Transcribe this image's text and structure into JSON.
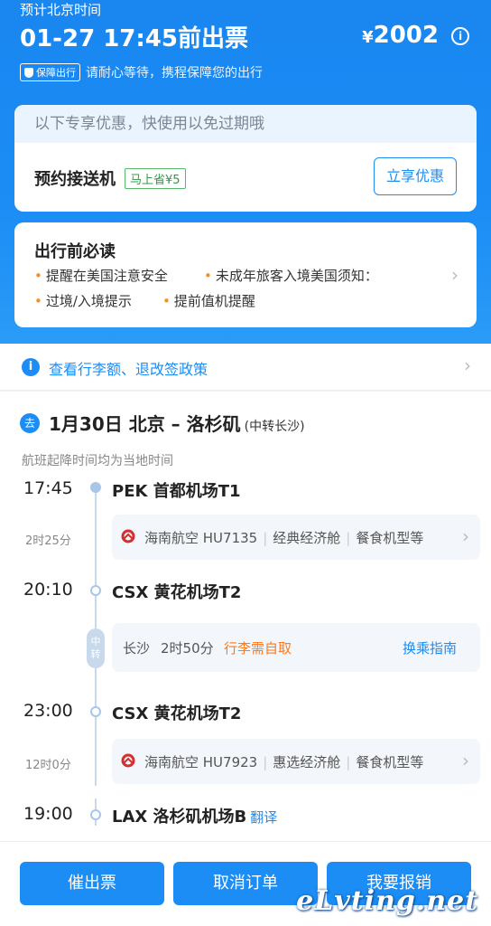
{
  "header": {
    "subtitle": "预计北京时间",
    "title": "01-27 17:45前出票",
    "price_symbol": "¥",
    "price": "2002",
    "guarantee_badge": "保障出行",
    "guarantee_text": "请耐心等待，携程保障您的出行"
  },
  "promo": {
    "banner": "以下专享优惠，快使用以免过期哦",
    "item_name": "预约接送机",
    "tag": "马上省¥5",
    "button": "立享优惠"
  },
  "notice": {
    "title": "出行前必读",
    "items": [
      "提醒在美国注意安全",
      "未成年旅客入境美国须知：",
      "过境/入境提示",
      "提前值机提醒"
    ]
  },
  "policy": {
    "text": "查看行李额、退改签政策"
  },
  "itinerary": {
    "badge": "去",
    "route": "1月30日  北京 – 洛杉矶",
    "route_note": "(中转长沙)",
    "local_time_note": "航班起降时间均为当地时间",
    "segments": [
      {
        "time": "17:45",
        "airport": "PEK 首都机场T1"
      },
      {
        "time": "20:10",
        "airport": "CSX 黄花机场T2"
      },
      {
        "time": "23:00",
        "airport": "CSX 黄花机场T2"
      },
      {
        "time": "19:00",
        "airport": "LAX 洛杉矶机场B",
        "translate": "翻译"
      }
    ],
    "flights": [
      {
        "duration": "2时25分",
        "airline": "海南航空 HU7135",
        "cabin": "经典经济舱",
        "meal": "餐食机型等"
      },
      {
        "duration": "12时0分",
        "airline": "海南航空 HU7923",
        "cabin": "惠选经济舱",
        "meal": "餐食机型等"
      }
    ],
    "transfer": {
      "marker": "中转",
      "city": "长沙",
      "duration": "2时50分",
      "baggage": "行李需自取",
      "guide": "换乘指南"
    }
  },
  "footer": {
    "buttons": [
      "催出票",
      "取消订单",
      "我要报销"
    ],
    "watermark": "eLvting.net"
  },
  "colors": {
    "primary": "#1b8df5",
    "orange": "#ff7a1a",
    "green": "#2c9b45"
  }
}
